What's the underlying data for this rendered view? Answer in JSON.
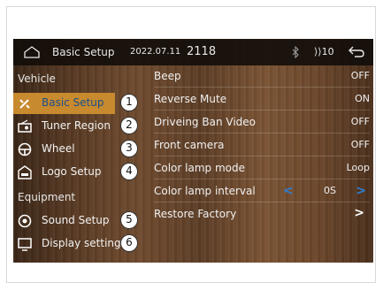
{
  "statusbar": {
    "title": "Basic Setup",
    "date": "2022.07.11",
    "time": "2118",
    "volume": "⟩⟩10",
    "icons": [
      "home-icon",
      "bluetooth-icon",
      "volume-icon",
      "back-icon"
    ]
  },
  "sidebar": {
    "section_vehicle": "Vehicle",
    "section_equipment": "Equipment",
    "items": [
      {
        "label": "Basic Setup",
        "badge": "1",
        "icon": "tools-icon"
      },
      {
        "label": "Tuner Region",
        "badge": "2",
        "icon": "radio-icon"
      },
      {
        "label": "Wheel",
        "badge": "3",
        "icon": "steering-wheel-icon"
      },
      {
        "label": "Logo Setup",
        "badge": "4",
        "icon": "car-logo-icon"
      },
      {
        "label": "Sound Setup",
        "badge": "5",
        "icon": "speaker-icon"
      },
      {
        "label": "Display settings",
        "badge": "6",
        "icon": "monitor-icon"
      }
    ]
  },
  "settings": [
    {
      "label": "Beep",
      "value": "OFF"
    },
    {
      "label": "Reverse Mute",
      "value": "ON"
    },
    {
      "label": "Driveing Ban Video",
      "value": "OFF"
    },
    {
      "label": "Front camera",
      "value": "OFF"
    },
    {
      "label": "Color lamp mode",
      "value": "Loop"
    },
    {
      "label": "Color lamp interval",
      "value": "0S"
    },
    {
      "label": "Restore Factory",
      "value": ""
    }
  ],
  "colors": {
    "accent": "#c88a2e",
    "chevron": "#2f7fd6",
    "active_text": "#1b4f8a"
  }
}
